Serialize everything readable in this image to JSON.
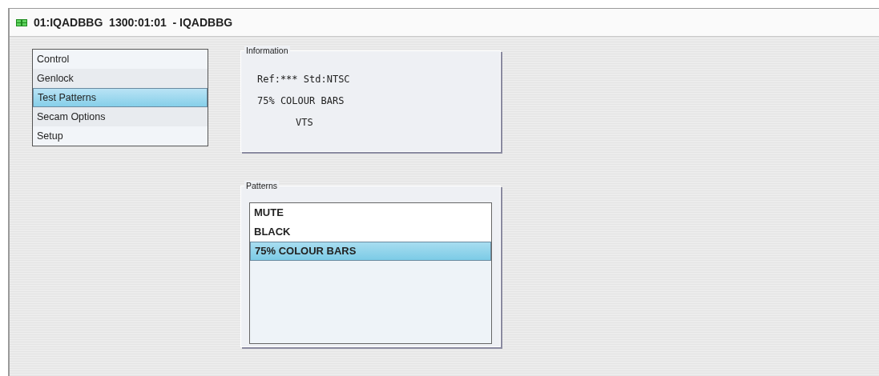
{
  "window": {
    "title": "01:IQADBBG  1300:01:01  - IQADBBG"
  },
  "nav": [
    {
      "label": "Control",
      "selected": false
    },
    {
      "label": "Genlock",
      "selected": false
    },
    {
      "label": "Test Patterns",
      "selected": true
    },
    {
      "label": "Secam Options",
      "selected": false
    },
    {
      "label": "Setup",
      "selected": false
    }
  ],
  "information": {
    "title": "Information",
    "lines": [
      "Ref:*** Std:NTSC",
      "75% COLOUR BARS",
      "VTS"
    ]
  },
  "patterns": {
    "title": "Patterns",
    "items": [
      {
        "label": "MUTE",
        "selected": false
      },
      {
        "label": "BLACK",
        "selected": false
      },
      {
        "label": "75% COLOUR BARS",
        "selected": true
      }
    ]
  }
}
